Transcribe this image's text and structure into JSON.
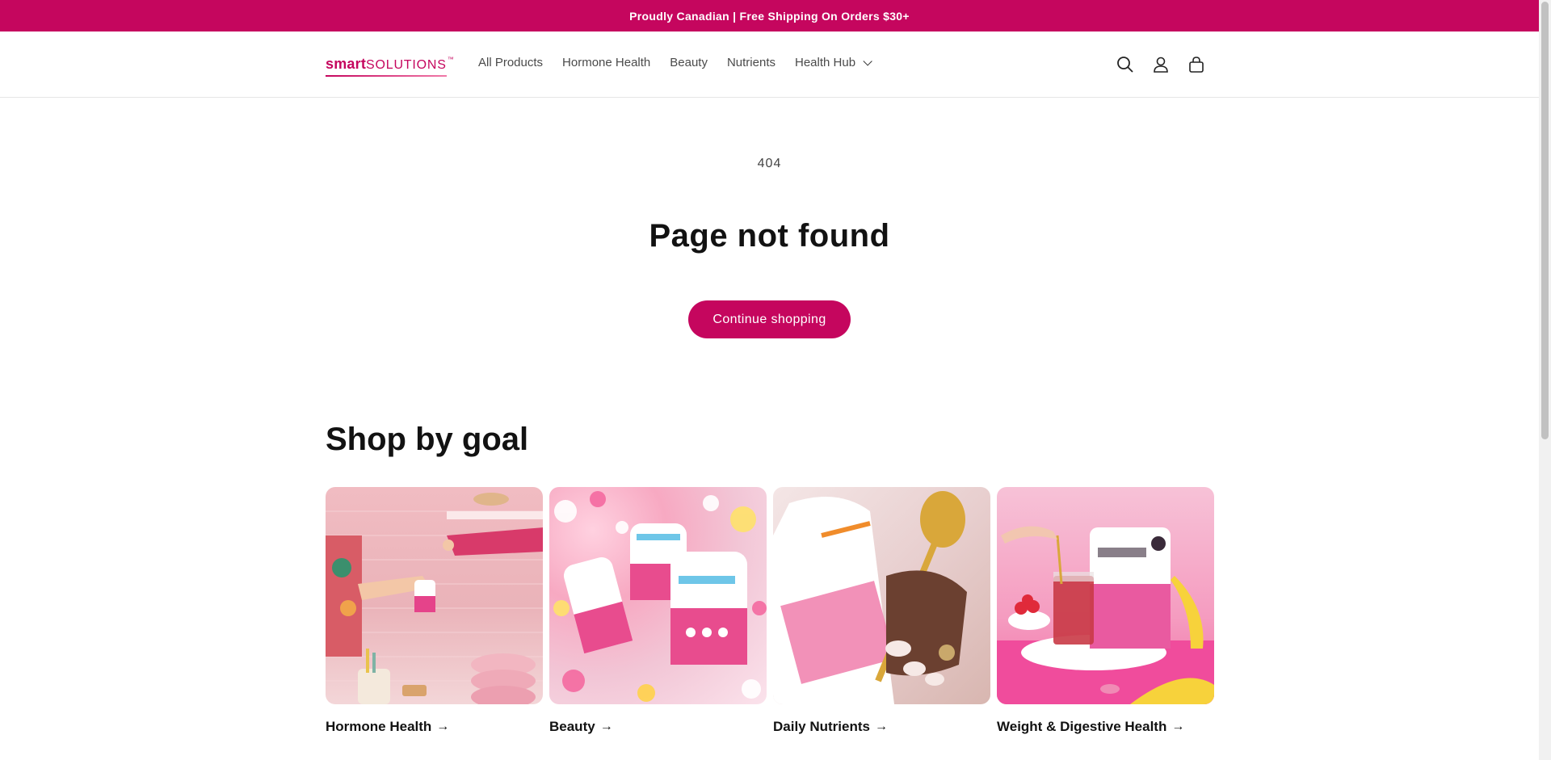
{
  "announcement": {
    "text": "Proudly Canadian | Free Shipping On Orders $30+"
  },
  "header": {
    "logo": {
      "bold": "smart",
      "light": "SOLUTIONS",
      "tm": "™"
    },
    "nav": [
      {
        "label": "All Products"
      },
      {
        "label": "Hormone Health"
      },
      {
        "label": "Beauty"
      },
      {
        "label": "Nutrients"
      },
      {
        "label": "Health Hub"
      }
    ],
    "icons": [
      "search-icon",
      "account-icon",
      "cart-icon"
    ]
  },
  "error": {
    "code": "404",
    "title": "Page not found",
    "cta_label": "Continue shopping"
  },
  "shop_by_goal": {
    "title": "Shop by goal",
    "cards": [
      {
        "label": "Hormone Health"
      },
      {
        "label": "Beauty"
      },
      {
        "label": "Daily Nutrients"
      },
      {
        "label": "Weight & Digestive Health"
      }
    ]
  },
  "theme": {
    "accent": "#c5065e"
  }
}
